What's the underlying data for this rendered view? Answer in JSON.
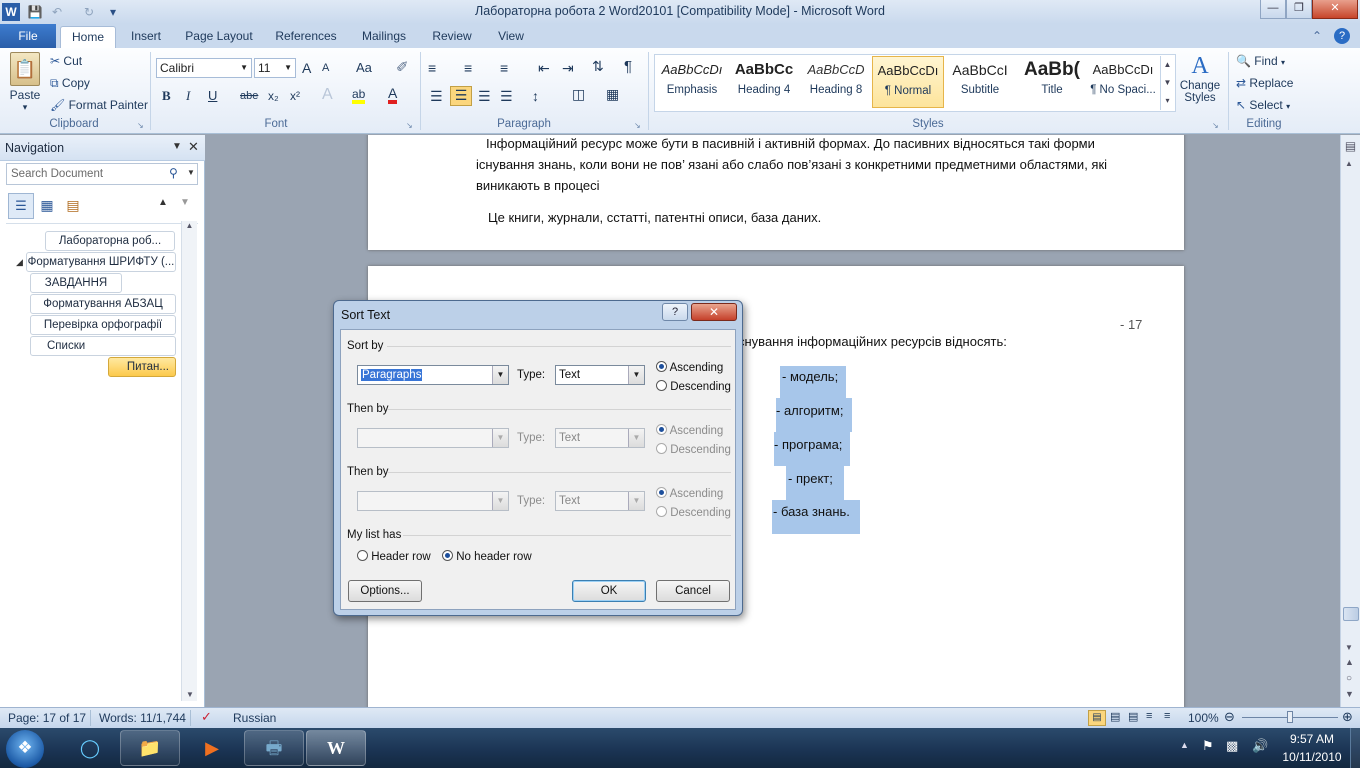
{
  "window": {
    "title": "Лабораторна робота 2 Word20101 [Compatibility Mode]  -  Microsoft Word",
    "app_icon": "W"
  },
  "ribbon_tabs": [
    "File",
    "Home",
    "Insert",
    "Page Layout",
    "References",
    "Mailings",
    "Review",
    "View"
  ],
  "clipboard": {
    "paste": "Paste",
    "cut": "Cut",
    "copy": "Copy",
    "format_painter": "Format Painter",
    "label": "Clipboard"
  },
  "font": {
    "name": "Calibri",
    "size": "11",
    "bold": "B",
    "italic": "I",
    "underline": "U",
    "strike": "abe",
    "sub": "x₂",
    "sup": "x²",
    "label": "Font",
    "grow": "A",
    "shrink": "A",
    "case": "Aa",
    "clear": "A",
    "highlight": "ab",
    "color": "A"
  },
  "paragraph": {
    "label": "Paragraph",
    "pilcrow": "¶"
  },
  "styles": {
    "label": "Styles",
    "items": [
      {
        "sample": "AaBbCcDı",
        "name": "Emphasis"
      },
      {
        "sample": "AaBbCc",
        "name": "Heading 4"
      },
      {
        "sample": "AaBbCcD",
        "name": "Heading 8"
      },
      {
        "sample": "AaBbCcDı",
        "name": "¶ Normal"
      },
      {
        "sample": "AaBbCcI",
        "name": "Subtitle"
      },
      {
        "sample": "AaBb(",
        "name": "Title"
      },
      {
        "sample": "AaBbCcDı",
        "name": "¶ No Spaci..."
      }
    ],
    "change_styles": "Change Styles"
  },
  "editing": {
    "find": "Find",
    "replace": "Replace",
    "select": "Select",
    "label": "Editing"
  },
  "navigation": {
    "title": "Navigation",
    "search_placeholder": "Search Document",
    "items": [
      {
        "label": "Лабораторна роб..."
      },
      {
        "label": "Форматування ШРИФТУ (..."
      },
      {
        "label": "ЗАВДАННЯ"
      },
      {
        "label": "Форматування АБЗАЦ"
      },
      {
        "label": "Перевірка орфографії"
      },
      {
        "label": "Списки"
      },
      {
        "label": "Питан..."
      }
    ]
  },
  "document": {
    "p1_line1": "Інформаційний ресурс може бути в пасивній і активній формах. До пасивних відносяться такі форми",
    "p1_line2": "існування знань, коли вони не пов’ язані або слабо пов’язані з конкретними предметними областями, які",
    "p1_line3": "виникають в процесі",
    "p2": "Це книги, журнали, сстатті, патентні описи, база даних.",
    "page_number": "- 17",
    "p3": "снування інформаційних ресурсів відносять:",
    "list": [
      "- модель;",
      "- алгоритм;",
      "- програма;",
      "- прект;",
      "- база знань."
    ]
  },
  "dialog": {
    "title": "Sort Text",
    "help": "?",
    "sort_by": "Sort by",
    "sort_by_value": "Paragraphs",
    "type_label": "Type:",
    "type_value": "Text",
    "ascending": "Ascending",
    "descending": "Descending",
    "then_by": "Then by",
    "then_by_2": "Then by",
    "type_value_2": "Text",
    "type_value_3": "Text",
    "my_list_has": "My list has",
    "header_row": "Header row",
    "no_header_row": "No header row",
    "options": "Options...",
    "ok": "OK",
    "cancel": "Cancel"
  },
  "status": {
    "page": "Page: 17 of 17",
    "words": "Words: 11/1,744",
    "language": "Russian",
    "zoom": "100%"
  },
  "taskbar": {
    "time": "9:57 AM",
    "date": "10/11/2010"
  },
  "colors": {
    "accent": "#2a5ea8",
    "selection": "#a7c6ea",
    "dialog_frame": "#bcd0e8"
  }
}
